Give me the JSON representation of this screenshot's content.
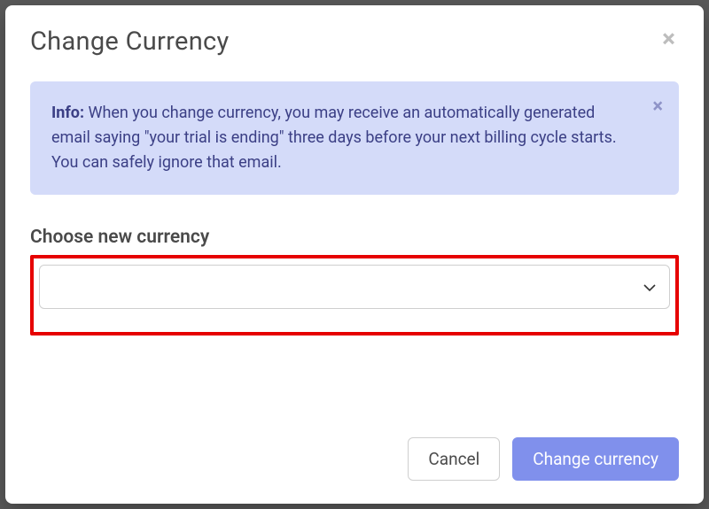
{
  "modal": {
    "title": "Change Currency",
    "close_symbol": "×"
  },
  "alert": {
    "label": "Info:",
    "message": " When you change currency, you may receive an automatically generated email saying \"your trial is ending\" three days before your next billing cycle starts. You can safely ignore that email.",
    "close_symbol": "×"
  },
  "form": {
    "label": "Choose new currency",
    "selected_value": ""
  },
  "footer": {
    "cancel_label": "Cancel",
    "submit_label": "Change currency"
  }
}
